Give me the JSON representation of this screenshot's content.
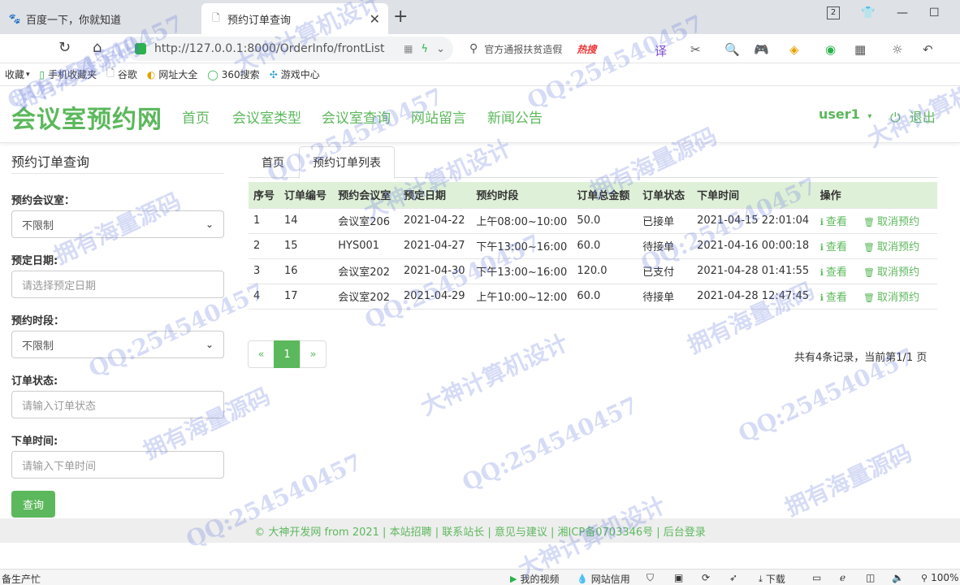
{
  "browser": {
    "tabs": [
      {
        "title": "百度一下，你就知道",
        "active": false
      },
      {
        "title": "预约订单查询",
        "active": true
      }
    ],
    "tab_count": "2",
    "url": "http://127.0.0.1:8000/OrderInfo/frontList",
    "search_text": "官方通报扶贫造假",
    "search_hot": "热搜",
    "bookmarks": [
      "收藏",
      "手机收藏夹",
      "谷歌",
      "网址大全",
      "360搜索",
      "游戏中心"
    ]
  },
  "site": {
    "brand": "会议室预约网",
    "nav": [
      "首页",
      "会议室类型",
      "会议室查询",
      "网站留言",
      "新闻公告"
    ],
    "user": "user1",
    "logout": "退出"
  },
  "sidebar": {
    "title": "预约订单查询",
    "fields": [
      {
        "label": "预约会议室：",
        "type": "select",
        "value": "不限制"
      },
      {
        "label": "预定日期:",
        "type": "input",
        "placeholder": "请选择预定日期"
      },
      {
        "label": "预约时段：",
        "type": "select",
        "value": "不限制"
      },
      {
        "label": "订单状态:",
        "type": "input",
        "placeholder": "请输入订单状态"
      },
      {
        "label": "下单时间:",
        "type": "input",
        "placeholder": "请输入下单时间"
      }
    ],
    "query_button": "查询"
  },
  "breadcrumb": {
    "home": "首页",
    "current": "预约订单列表"
  },
  "table": {
    "headers": [
      "序号",
      "订单编号",
      "预约会议室",
      "预定日期",
      "预约时段",
      "订单总金额",
      "订单状态",
      "下单时间",
      "操作"
    ],
    "rows": [
      [
        "1",
        "14",
        "会议室206",
        "2021-04-22",
        "上午08:00~10:00",
        "50.0",
        "已接单",
        "2021-04-15 22:01:04"
      ],
      [
        "2",
        "15",
        "HYS001",
        "2021-04-27",
        "下午13:00~16:00",
        "60.0",
        "待接单",
        "2021-04-16 00:00:18"
      ],
      [
        "3",
        "16",
        "会议室202",
        "2021-04-30",
        "下午13:00~16:00",
        "120.0",
        "已支付",
        "2021-04-28 01:41:55"
      ],
      [
        "4",
        "17",
        "会议室202",
        "2021-04-29",
        "上午10:00~12:00",
        "60.0",
        "待接单",
        "2021-04-28 12:47:45"
      ]
    ],
    "view_label": "查看",
    "cancel_label": "取消预约"
  },
  "pager": {
    "prev": "«",
    "current": "1",
    "next": "»",
    "info": "共有4条记录，当前第1/1 页"
  },
  "footer": "© 大神开发网 from 2021 | 本站招聘 | 联系站长 | 意见与建议 | 湘ICP备0703346号 | 后台登录",
  "statusbar": {
    "left": "备生产忙",
    "items": [
      "我的视频",
      "网站信用",
      "下载"
    ],
    "zoom": "100%"
  },
  "watermarks": [
    "QQ:254540457",
    "大神计算机设计",
    "拥有海量源码"
  ],
  "colors": {
    "accent": "#5cb85c",
    "header_bg": "#dff0d8"
  }
}
